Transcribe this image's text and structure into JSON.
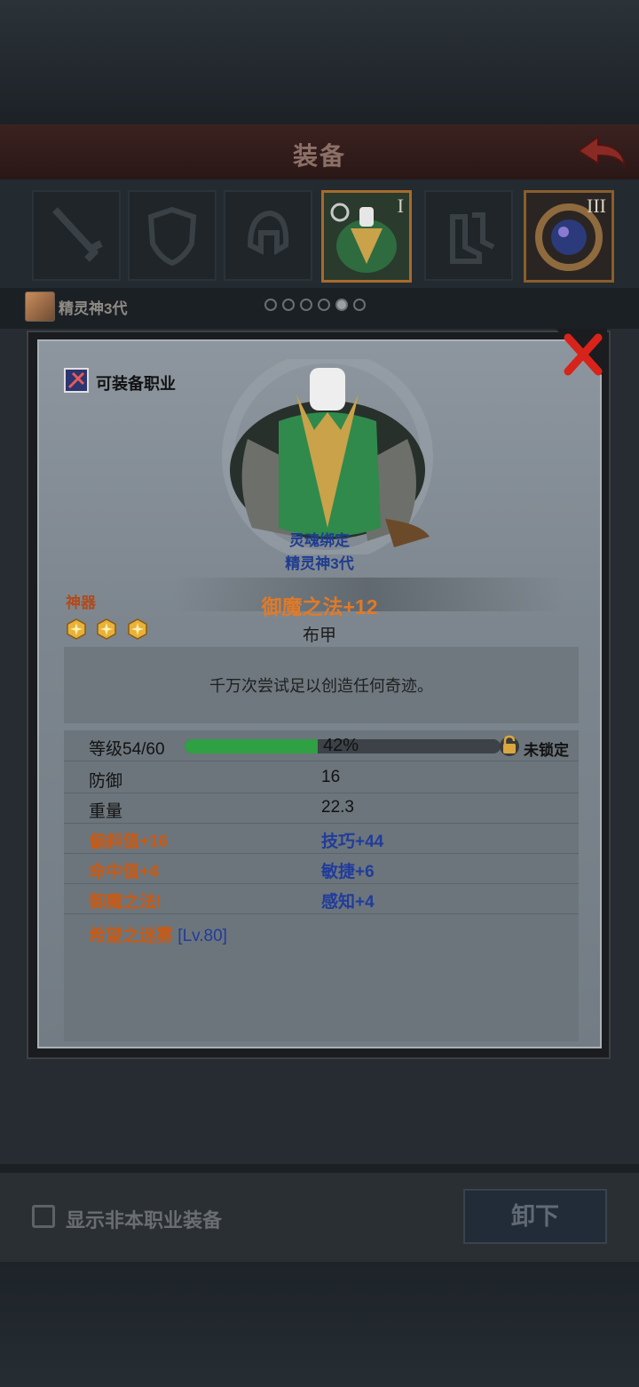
{
  "header": {
    "title": "装备"
  },
  "tabs": [
    {
      "roman": ""
    },
    {
      "roman": ""
    },
    {
      "roman": ""
    },
    {
      "roman": "I"
    },
    {
      "roman": ""
    },
    {
      "roman": "III"
    }
  ],
  "character": {
    "name": "精灵神3代"
  },
  "pager": {
    "count": 6,
    "active": 4
  },
  "popup": {
    "class_label": "可装备职业",
    "soulbound": "灵魂绑定",
    "bound_to": "精灵神3代",
    "rarity": "神器",
    "star_count": 3,
    "item_name": "御魔之法+12",
    "item_type": "布甲",
    "description": "千万次尝试足以创造任何奇迹。",
    "level": {
      "label": "等级54/60",
      "percent_text": "42%",
      "progress": 0.42,
      "lock_text": "未锁定"
    },
    "stats": [
      {
        "left": "防御",
        "right": "16"
      },
      {
        "left": "重量",
        "right": "22.3"
      },
      {
        "left": "偏斜值+16",
        "right": "技巧+44"
      },
      {
        "left": "命中值+4",
        "right": "敏捷+6"
      },
      {
        "left": "御魔之法I",
        "right": "感知+4"
      }
    ],
    "set_skill": {
      "name": "希望之迷雾",
      "level": "[Lv.80]"
    }
  },
  "bottom": {
    "checkbox_label": "显示非本职业装备",
    "unequip_label": "卸下"
  },
  "colors": {
    "accent_orange": "#e07a28",
    "bound_blue": "#1f3d8f",
    "progress_green": "#2fa043"
  }
}
